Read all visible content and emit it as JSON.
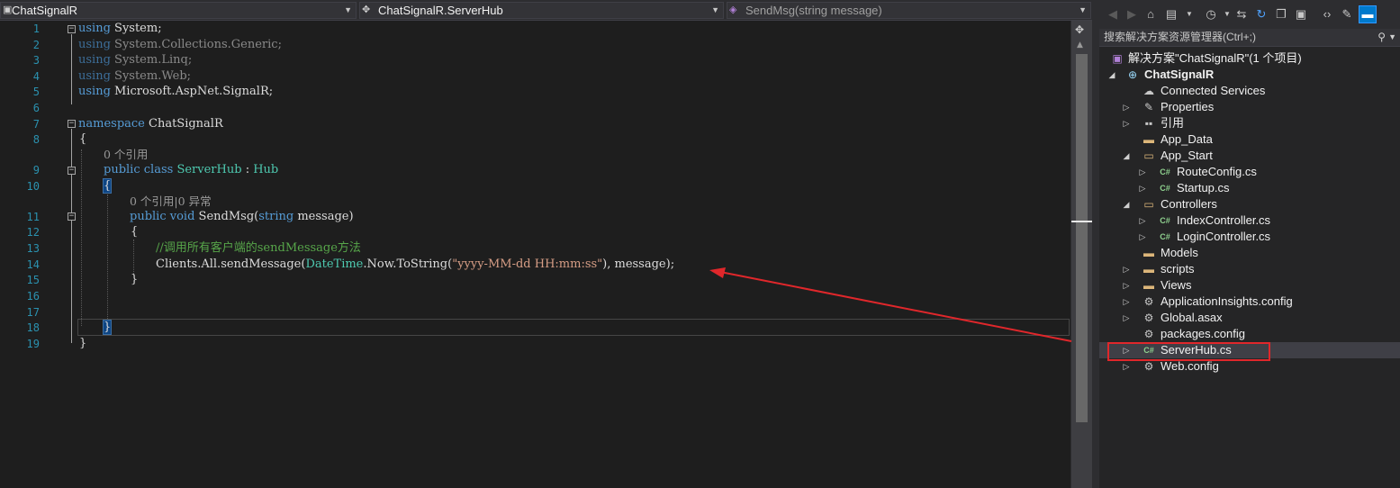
{
  "navbar": {
    "project": "ChatSignalR",
    "class": "ChatSignalR.ServerHub",
    "member": "SendMsg(string message)"
  },
  "lines": {
    "l1": {
      "kw": "using",
      "rest": " System;"
    },
    "l2": {
      "kw": "using",
      "rest": " System.Collections.Generic;"
    },
    "l3": {
      "kw": "using",
      "rest": " System.Linq;"
    },
    "l4": {
      "kw": "using",
      "rest": " System.Web;"
    },
    "l5": {
      "kw": "using",
      "rest": " Microsoft.AspNet.SignalR;"
    },
    "l7": {
      "kw": "namespace",
      "rest": " ChatSignalR"
    },
    "l8": {
      "text": "{"
    },
    "lens9": "0 个引用",
    "l9": {
      "kw1": "public",
      "kw2": "class",
      "cls": "ServerHub",
      "sep": " : ",
      "base": "Hub"
    },
    "l10": {
      "text": "{"
    },
    "lens11": "0 个引用|0 异常",
    "l11": {
      "kw1": "public",
      "kw2": "void",
      "name": " SendMsg(",
      "kw3": "string",
      "rest": " message)"
    },
    "l12": {
      "text": "{"
    },
    "l13": {
      "comment": "//调用所有客户端的sendMessage方法"
    },
    "l14": {
      "a": "Clients.All.sendMessage(",
      "type": "DateTime",
      "b": ".Now.ToString(",
      "str": "\"yyyy-MM-dd HH:mm:ss\"",
      "c": "), message);"
    },
    "l15": {
      "text": "}"
    },
    "l18": {
      "text": "}"
    },
    "l19": {
      "text": "}"
    }
  },
  "line_numbers": [
    "1",
    "2",
    "3",
    "4",
    "5",
    "6",
    "7",
    "8",
    "9",
    "10",
    "11",
    "12",
    "13",
    "14",
    "15",
    "16",
    "17",
    "18",
    "19"
  ],
  "solution": {
    "search_placeholder": "搜索解决方案资源管理器(Ctrl+;)",
    "items": [
      {
        "label": "解决方案\"ChatSignalR\"(1 个项目)",
        "icon": "solution-icon"
      },
      {
        "label": "ChatSignalR",
        "icon": "web-project-icon"
      },
      {
        "label": "Connected Services",
        "icon": "connected-services-icon"
      },
      {
        "label": "Properties",
        "icon": "wrench-icon"
      },
      {
        "label": "引用",
        "icon": "references-icon"
      },
      {
        "label": "App_Data",
        "icon": "folder-icon"
      },
      {
        "label": "App_Start",
        "icon": "folder-open-icon"
      },
      {
        "label": "RouteConfig.cs",
        "icon": "csharp-file-icon"
      },
      {
        "label": "Startup.cs",
        "icon": "csharp-file-icon"
      },
      {
        "label": "Controllers",
        "icon": "folder-open-icon"
      },
      {
        "label": "IndexController.cs",
        "icon": "csharp-file-icon"
      },
      {
        "label": "LoginController.cs",
        "icon": "csharp-file-icon"
      },
      {
        "label": "Models",
        "icon": "folder-icon"
      },
      {
        "label": "scripts",
        "icon": "folder-icon"
      },
      {
        "label": "Views",
        "icon": "folder-icon"
      },
      {
        "label": "ApplicationInsights.config",
        "icon": "config-file-icon"
      },
      {
        "label": "Global.asax",
        "icon": "asax-file-icon"
      },
      {
        "label": "packages.config",
        "icon": "config-file-icon"
      },
      {
        "label": "ServerHub.cs",
        "icon": "csharp-file-icon"
      },
      {
        "label": "Web.config",
        "icon": "config-file-icon"
      }
    ]
  },
  "colors": {
    "keyword": "#569cd6",
    "type": "#4ec9b0",
    "string": "#d69d85",
    "comment": "#57a64a",
    "line_number": "#2b91af",
    "annotation_red": "#e0272b"
  }
}
